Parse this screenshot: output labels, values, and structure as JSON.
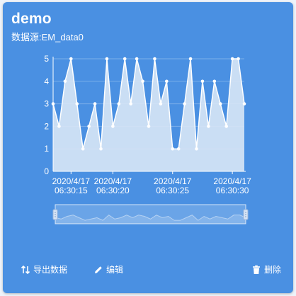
{
  "card": {
    "title": "demo",
    "source_label": "数据源",
    "source_sep": ":",
    "source_value": "EM_data0"
  },
  "chart_data": {
    "type": "area",
    "title": "",
    "xlabel": "",
    "ylabel": "",
    "ylim": [
      0,
      5
    ],
    "yticks": [
      0,
      1,
      2,
      3,
      4,
      5
    ],
    "grid": true,
    "values": [
      3,
      2,
      4,
      5,
      3,
      1,
      2,
      3,
      1,
      5,
      2,
      3,
      5,
      3,
      5,
      4,
      2,
      5,
      3,
      4,
      1,
      1,
      3,
      5,
      1,
      4,
      2,
      4,
      3,
      2,
      5,
      5,
      3
    ],
    "xtick_labels": [
      {
        "index": 3,
        "date": "2020/4/17",
        "time": "06:30:15"
      },
      {
        "index": 10,
        "date": "2020/4/17",
        "time": "06:30:20"
      },
      {
        "index": 20,
        "date": "2020/4/17",
        "time": "06:30:25"
      },
      {
        "index": 30,
        "date": "2020/4/17",
        "time": "06:30:30"
      }
    ],
    "colors": {
      "line": "#ffffff",
      "area": "#dce8f6",
      "axis": "#ffffff"
    }
  },
  "actions": {
    "export": {
      "label": "导出数据",
      "icon": "sort-arrows-icon"
    },
    "edit": {
      "label": "编辑",
      "icon": "pencil-icon"
    },
    "delete": {
      "label": "删除",
      "icon": "trash-icon"
    }
  }
}
